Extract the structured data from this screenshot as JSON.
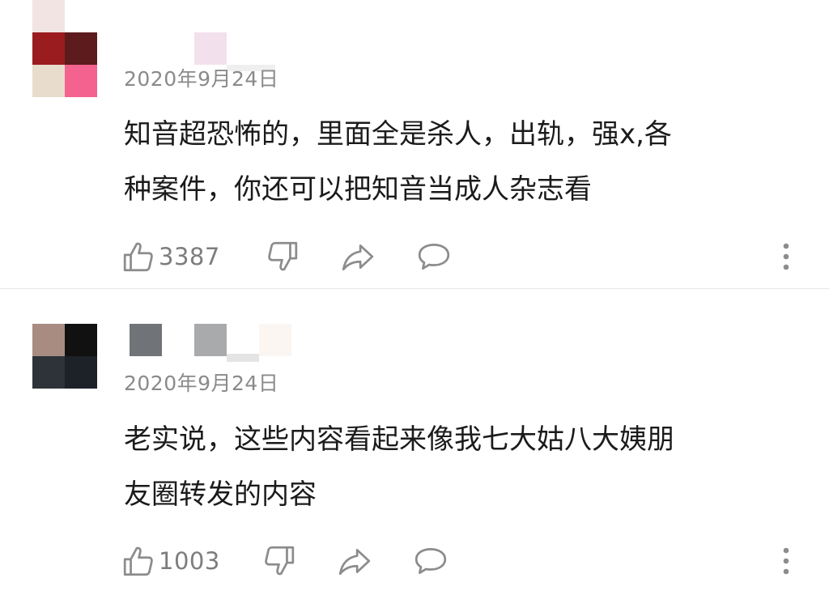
{
  "comments": [
    {
      "date": "2020年9月24日",
      "text_line1": "知音超恐怖的，里面全是杀人，出轨，强x,各",
      "text_line2": "种案件，你还可以把知音当成人杂志看",
      "like_count": "3387",
      "avatar_colors": [
        "#9a1c1e",
        "#5e1b1e",
        "#e8dccd",
        "#f4628f"
      ]
    },
    {
      "date": "2020年9月24日",
      "text_line1": "老实说，这些内容看起来像我七大姑八大姨朋",
      "text_line2": "友圈转发的内容",
      "like_count": "1003",
      "avatar_colors": [
        "#a88c82",
        "#111112",
        "#2e3339",
        "#1d2229"
      ]
    }
  ],
  "icons": {
    "like": "thumbs-up-icon",
    "dislike": "thumbs-down-icon",
    "share": "share-arrow-icon",
    "reply": "comment-bubble-icon",
    "more": "more-vertical-icon"
  },
  "colors": {
    "text": "#1b1b1b",
    "meta": "#8a8a8a",
    "icon": "#8c8c8c",
    "divider": "#e6e6e6"
  }
}
